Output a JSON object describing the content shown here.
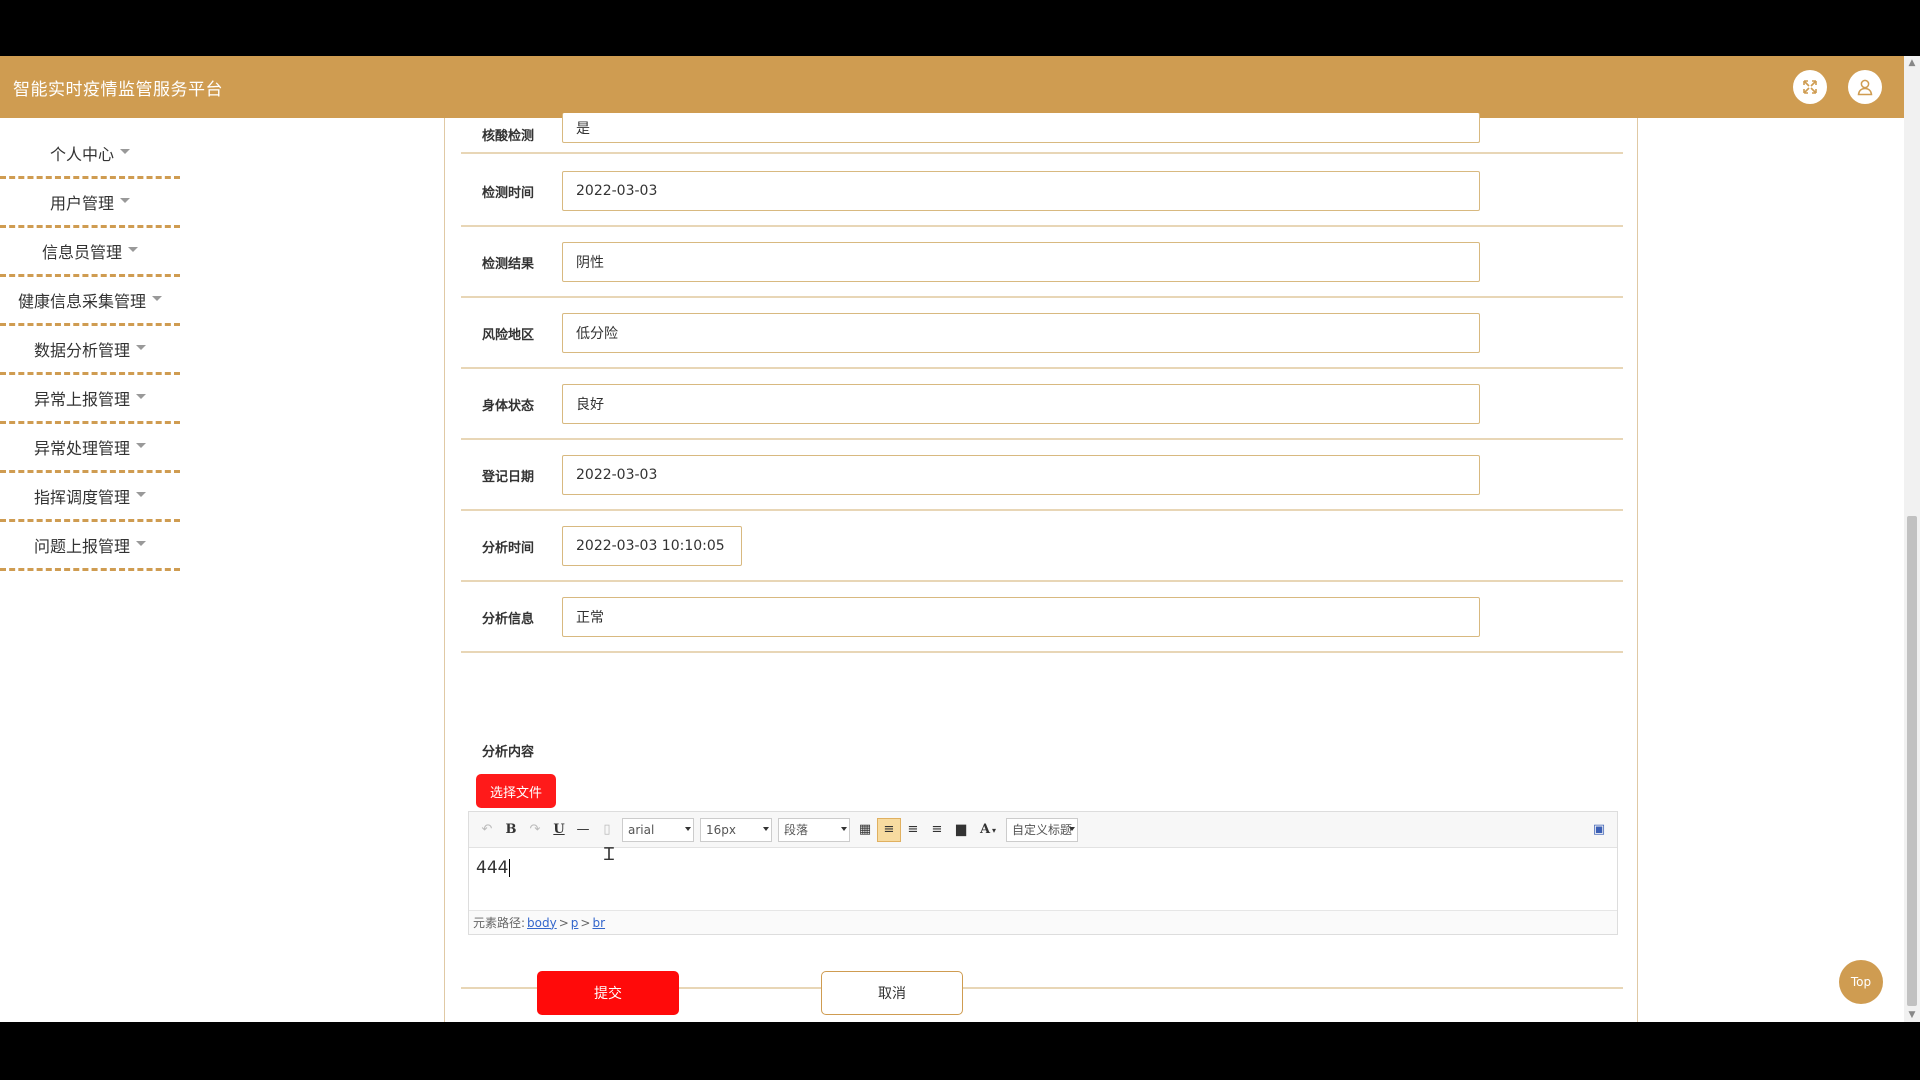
{
  "header": {
    "title": "智能实时疫情监管服务平台",
    "fullscreen_icon": "fullscreen-icon",
    "user_icon": "user-icon"
  },
  "sidebar": {
    "items": [
      {
        "label": "个人中心"
      },
      {
        "label": "用户管理"
      },
      {
        "label": "信息员管理"
      },
      {
        "label": "健康信息采集管理"
      },
      {
        "label": "数据分析管理"
      },
      {
        "label": "异常上报管理"
      },
      {
        "label": "异常处理管理"
      },
      {
        "label": "指挥调度管理"
      },
      {
        "label": "问题上报管理"
      }
    ]
  },
  "form": {
    "fields": [
      {
        "label": "核酸检测",
        "value": "是"
      },
      {
        "label": "检测时间",
        "value": "2022-03-03"
      },
      {
        "label": "检测结果",
        "value": "阴性"
      },
      {
        "label": "风险地区",
        "value": "低分险"
      },
      {
        "label": "身体状态",
        "value": "良好"
      },
      {
        "label": "登记日期",
        "value": "2022-03-03"
      },
      {
        "label": "分析时间",
        "value": "2022-03-03 10:10:05"
      },
      {
        "label": "分析信息",
        "value": "正常"
      }
    ],
    "editor_label": "分析内容",
    "choose_file": "选择文件",
    "toolbar": {
      "font": "arial",
      "size": "16px",
      "paragraph": "段落",
      "custom_title": "自定义标题",
      "bold": "B",
      "underline": "U",
      "font_color": "A"
    },
    "content": "444",
    "path_label": "元素路径:",
    "path": [
      "body",
      "p",
      "br"
    ],
    "submit": "提交",
    "cancel": "取消"
  },
  "top_button": "Top"
}
